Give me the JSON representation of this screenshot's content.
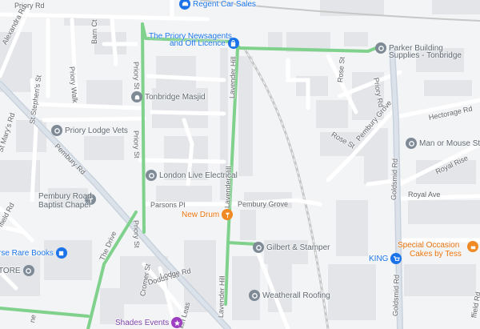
{
  "map": {
    "colors": {
      "background": "#f3f4f6",
      "building": "#e3e5e8",
      "road": "#ffffff",
      "road_casing": "#dadce0",
      "major_road": "#c9d2dd",
      "route": "#7fd18c",
      "rail": "#c7c7c7"
    },
    "roads": {
      "priory_rd_top": "Priory Rd",
      "alexandra_rd": "Alexandra Rd",
      "barn_ct": "Barn Ct",
      "priory_walk": "Priory Walk",
      "priory_st_upper": "Priory St",
      "priory_st_middle": "Priory St",
      "priory_st_lower": "Priory St",
      "st_stephens_st": "St Stephen's St",
      "st_marys_rd": "St Mary's Rd",
      "pembury_rd": "Pembury Rd",
      "lavender_hill_upper": "Lavender Hill",
      "lavender_hill_middle": "Lavender Hill",
      "lavender_hill_lower": "Lavender Hill",
      "pembury_grove": "Pembury Grove",
      "parsons_pl": "Parsons Pl",
      "the_drive": "The Drive",
      "cromer_rd": "Cromer St",
      "dodds_rd": "Dodds Rd",
      "lodge_rd": "Lodge Rd",
      "rose_st": "Rose St",
      "rose_st_2": "Rose St",
      "pembury_grove_2": "Pembury Grove",
      "priory_rd_right": "Priory Rd",
      "goldsmid_rd_upper": "Goldsmid Rd",
      "goldsmid_rd_lower": "Goldsmid Rd",
      "hectorage_rd": "Hectorage Rd",
      "royal_rise": "Royal Rise",
      "royal_ave": "Royal Ave",
      "fairfield_rd": "ffield Rd",
      "fairfield_rd_2": "ffield Rd",
      "larkin": "kin Leas",
      "st_marys_lower": "ne"
    },
    "pois": {
      "regent_car_sales": "Regent Car Sales",
      "priory_newsagents_line1": "The Priory Newsagents",
      "priory_newsagents_line2": "and Off Licence",
      "parker_line1": "Parker Building",
      "parker_line2": "Supplies - Tonbridge",
      "tonbridge_masjid": "Tonbridge Masjid",
      "priory_lodge_vets": "Priory Lodge Vets",
      "london_live_electrical": "London Live Electrical",
      "pembury_chapel_line1": "Pembury Road",
      "pembury_chapel_line2": "Baptist Chapel",
      "new_drum": "New Drum",
      "gilbert_stamper": "Gilbert & Stamper",
      "weatherall_roofing": "Weatherall Roofing",
      "man_or_mouse": "Man or Mouse Studi",
      "king": "KING",
      "special_line1": "Special Occasion",
      "special_line2": "Cakes by Tess",
      "rare_books": "rse Rare Books",
      "tore": "TORE",
      "shades_events": "Shades Events"
    }
  }
}
